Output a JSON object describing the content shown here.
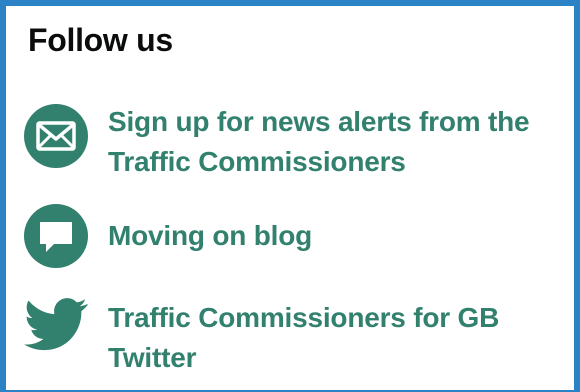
{
  "section": {
    "title": "Follow us"
  },
  "links": [
    {
      "label": "Sign up for news alerts from the Traffic Commissioners",
      "icon": "email-icon"
    },
    {
      "label": "Moving on blog",
      "icon": "speech-bubble-icon"
    },
    {
      "label": "Traffic Commissioners for GB Twitter",
      "icon": "twitter-bird-icon"
    }
  ],
  "colors": {
    "link": "#32806e",
    "heading": "#0b0c0c",
    "border": "#2b82c4"
  }
}
